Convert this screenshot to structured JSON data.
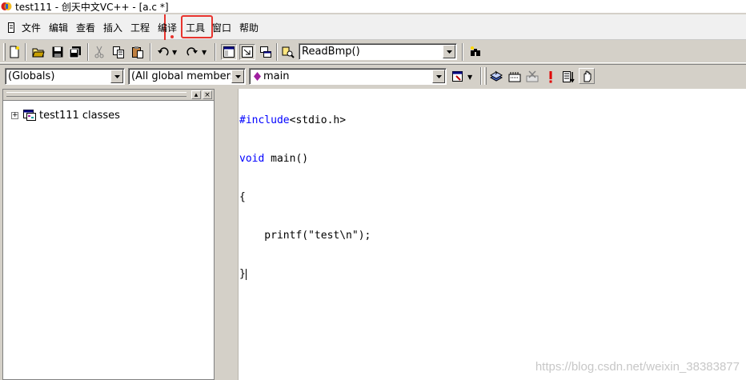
{
  "window": {
    "title": "test111 - 创天中文VC++ - [a.c *]"
  },
  "menu": {
    "items": [
      {
        "label": "文件"
      },
      {
        "label": "编辑"
      },
      {
        "label": "查看"
      },
      {
        "label": "插入"
      },
      {
        "label": "工程"
      },
      {
        "label": "编译"
      },
      {
        "label": "工具"
      },
      {
        "label": "窗口"
      },
      {
        "label": "帮助"
      }
    ],
    "highlight_color": "#e8342e"
  },
  "toolbar1": {
    "icons": [
      "new-file-icon",
      "open-folder-icon",
      "save-icon",
      "save-all-icon",
      "cut-icon",
      "copy-icon",
      "paste-icon",
      "undo-icon",
      "redo-icon",
      "workspace-icon",
      "output-icon",
      "window-list-icon",
      "find-in-files-icon",
      "find-icon"
    ],
    "find_combo_value": "ReadBmp()"
  },
  "toolbar2": {
    "scope_combo": "(Globals)",
    "members_combo": "(All global members",
    "function_combo": "main",
    "icons": [
      "wizard-action-icon",
      "compile-icon",
      "build-icon",
      "stop-build-icon",
      "execute-icon",
      "go-icon",
      "breakpoint-icon"
    ]
  },
  "workspace": {
    "tree_root": "test111 classes"
  },
  "editor": {
    "lines": [
      {
        "kw": "#include",
        "rest": "<stdio.h>"
      },
      {
        "kw": "void",
        "rest": " main()"
      },
      {
        "kw": "",
        "rest": "{"
      },
      {
        "kw": "",
        "rest": "    printf(\"test\\n\");"
      },
      {
        "kw": "",
        "rest": "}"
      }
    ]
  },
  "watermark": "https://blog.csdn.net/weixin_38383877"
}
